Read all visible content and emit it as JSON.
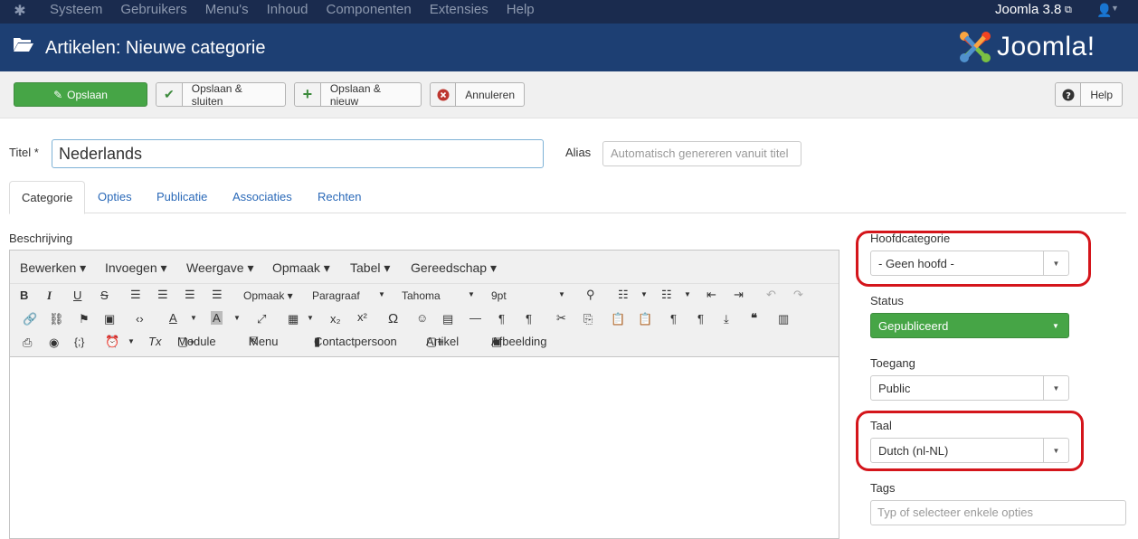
{
  "navbar": {
    "menu": [
      "Systeem",
      "Gebruikers",
      "Menu's",
      "Inhoud",
      "Componenten",
      "Extensies",
      "Help"
    ],
    "version": "Joomla 3.8"
  },
  "header": {
    "title": "Artikelen: Nieuwe categorie",
    "brand": "Joomla!"
  },
  "toolbar": {
    "save": "Opslaan",
    "save_close": "Opslaan & sluiten",
    "save_new": "Opslaan & nieuw",
    "cancel": "Annuleren",
    "help": "Help"
  },
  "form": {
    "title_label": "Titel *",
    "title_value": "Nederlands",
    "alias_label": "Alias",
    "alias_placeholder": "Automatisch genereren vanuit titel"
  },
  "tabs": [
    "Categorie",
    "Opties",
    "Publicatie",
    "Associaties",
    "Rechten"
  ],
  "editor": {
    "label": "Beschrijving",
    "menus": [
      "Bewerken ▾",
      "Invoegen ▾",
      "Weergave ▾",
      "Opmaak ▾",
      "Tabel ▾",
      "Gereedschap ▾"
    ],
    "format_select": "Opmaak ▾",
    "block_select": "Paragraaf",
    "font_select": "Tahoma",
    "size_select": "9pt",
    "plugin_buttons": [
      "Module",
      "Menu",
      "Contactpersoon",
      "Artikel",
      "Afbeelding"
    ]
  },
  "sidebar": {
    "parent_label": "Hoofdcategorie",
    "parent_value": "- Geen hoofd -",
    "status_label": "Status",
    "status_value": "Gepubliceerd",
    "access_label": "Toegang",
    "access_value": "Public",
    "language_label": "Taal",
    "language_value": "Dutch (nl-NL)",
    "tags_label": "Tags",
    "tags_placeholder": "Typ of selecteer enkele opties"
  }
}
